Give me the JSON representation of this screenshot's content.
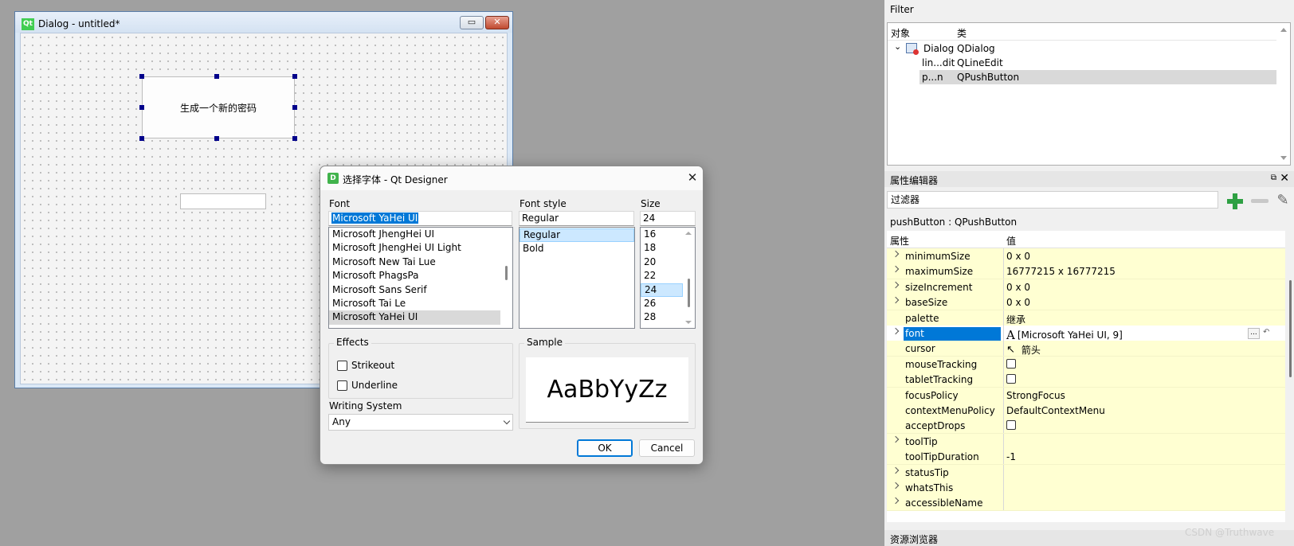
{
  "form_window": {
    "logo": "Qt",
    "title": "Dialog - untitled*",
    "minimize_glyph": "▭",
    "close_glyph": "✕",
    "push_button_text": "生成一个新的密码"
  },
  "font_dialog": {
    "icon_letter": "D",
    "title": "选择字体 - Qt Designer",
    "close_glyph": "✕",
    "font_label": "Font",
    "font_value": "Microsoft YaHei UI",
    "font_list": [
      "Microsoft JhengHei UI",
      "Microsoft JhengHei UI Light",
      "Microsoft New Tai Lue",
      "Microsoft PhagsPa",
      "Microsoft Sans Serif",
      "Microsoft Tai Le",
      "Microsoft YaHei UI"
    ],
    "style_label": "Font style",
    "style_value": "Regular",
    "style_list": [
      "Regular",
      "Bold"
    ],
    "size_label": "Size",
    "size_value": "24",
    "size_list": [
      "16",
      "18",
      "20",
      "22",
      "24",
      "26",
      "28"
    ],
    "effects_label": "Effects",
    "strikeout_label": "Strikeout",
    "underline_label": "Underline",
    "sample_label": "Sample",
    "sample_text": "AaBbYyZz",
    "writing_system_label": "Writing System",
    "writing_system_value": "Any",
    "ok_label": "OK",
    "cancel_label": "Cancel"
  },
  "object_inspector": {
    "filter_label": "Filter",
    "col_object": "对象",
    "col_class": "类",
    "rows": [
      {
        "object": "Dialog",
        "class": "QDialog"
      },
      {
        "object": "lin...dit",
        "class": "QLineEdit"
      },
      {
        "object": "p...n",
        "class": "QPushButton"
      }
    ]
  },
  "property_editor": {
    "title": "属性编辑器",
    "float_glyph": "⧉",
    "close_glyph": "✕",
    "filter_placeholder": "过滤器",
    "object_label": "pushButton : QPushButton",
    "col_property": "属性",
    "col_value": "值",
    "properties": [
      {
        "name": "minimumSize",
        "value": "0 x 0",
        "expandable": true
      },
      {
        "name": "maximumSize",
        "value": "16777215 x 16777215",
        "expandable": true
      },
      {
        "name": "sizeIncrement",
        "value": "0 x 0",
        "expandable": true
      },
      {
        "name": "baseSize",
        "value": "0 x 0",
        "expandable": true
      },
      {
        "name": "palette",
        "value": "继承",
        "expandable": false
      },
      {
        "name": "font",
        "value": "[Microsoft YaHei UI, 9]",
        "expandable": true
      },
      {
        "name": "cursor",
        "value": "箭头",
        "expandable": false
      },
      {
        "name": "mouseTracking",
        "value": "",
        "expandable": false
      },
      {
        "name": "tabletTracking",
        "value": "",
        "expandable": false
      },
      {
        "name": "focusPolicy",
        "value": "StrongFocus",
        "expandable": false
      },
      {
        "name": "contextMenuPolicy",
        "value": "DefaultContextMenu",
        "expandable": false
      },
      {
        "name": "acceptDrops",
        "value": "",
        "expandable": false
      },
      {
        "name": "toolTip",
        "value": "",
        "expandable": true
      },
      {
        "name": "toolTipDuration",
        "value": "-1",
        "expandable": false
      },
      {
        "name": "statusTip",
        "value": "",
        "expandable": true
      },
      {
        "name": "whatsThis",
        "value": "",
        "expandable": true
      },
      {
        "name": "accessibleName",
        "value": "",
        "expandable": true
      }
    ],
    "font_glyph": "A",
    "cursor_glyph": "↖",
    "dots_label": "..."
  },
  "resource_browser": {
    "title": "资源浏览器"
  },
  "watermark": "CSDN @Truthwave",
  "colors": {
    "accent": "#0078d7",
    "property_row": "#ffffd2",
    "selection_light": "#cce8ff"
  }
}
